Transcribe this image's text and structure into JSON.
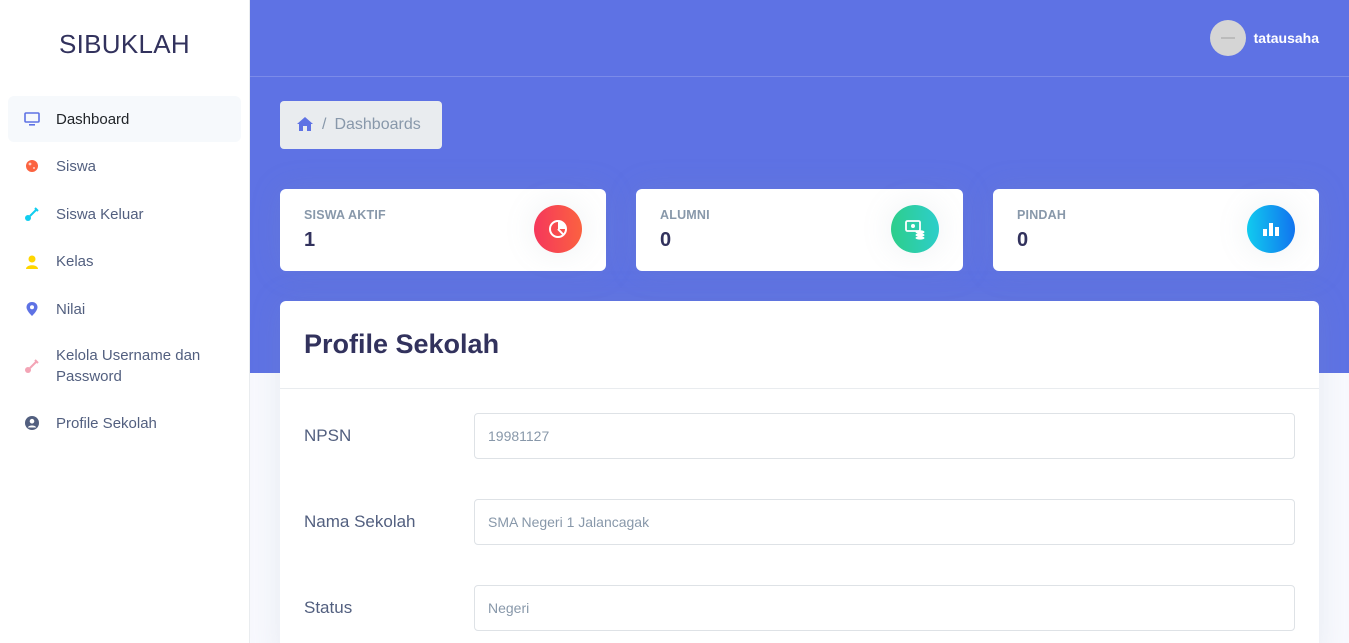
{
  "brand": "SIBUKLAH",
  "sidebar": {
    "items": [
      {
        "label": "Dashboard",
        "icon": "monitor-icon",
        "color": "#5e72e4",
        "active": true
      },
      {
        "label": "Siswa",
        "icon": "planet-icon",
        "color": "#fb6340"
      },
      {
        "label": "Siswa Keluar",
        "icon": "pin-icon",
        "color": "#11cdef"
      },
      {
        "label": "Kelas",
        "icon": "user-icon",
        "color": "#ffd600"
      },
      {
        "label": "Nilai",
        "icon": "map-pin-icon",
        "color": "#5e72e4"
      },
      {
        "label": "Kelola Username dan Password",
        "icon": "key-icon",
        "color": "#f3a4b5"
      },
      {
        "label": "Profile Sekolah",
        "icon": "user-circle-icon",
        "color": "#525f7f"
      }
    ]
  },
  "header": {
    "username": "tatausaha",
    "accent": "#5e72e4"
  },
  "breadcrumb": {
    "home_icon": "home-icon",
    "current": "Dashboards"
  },
  "stats": [
    {
      "title": "SISWA AKTIF",
      "value": "1",
      "icon": "pie-chart-icon",
      "gradient": [
        "#f5365c",
        "#fb6340"
      ]
    },
    {
      "title": "ALUMNI",
      "value": "0",
      "icon": "money-coins-icon",
      "gradient": [
        "#2dce89",
        "#2dcecc"
      ]
    },
    {
      "title": "PINDAH",
      "value": "0",
      "icon": "bar-chart-icon",
      "gradient": [
        "#11cdef",
        "#1171ef"
      ]
    }
  ],
  "profile": {
    "title": "Profile Sekolah",
    "fields": [
      {
        "label": "NPSN",
        "value": "19981127"
      },
      {
        "label": "Nama Sekolah",
        "value": "SMA Negeri 1 Jalancagak"
      },
      {
        "label": "Status",
        "value": "Negeri"
      }
    ]
  }
}
